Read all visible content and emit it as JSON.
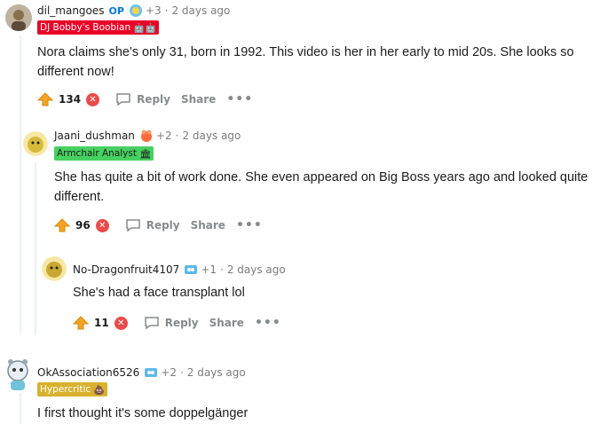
{
  "colors": {
    "upvote": "#f2a325",
    "downvote": "#ea4a4a",
    "op": "#0079d3",
    "flair_red": "#ea0027",
    "flair_green": "#46d160",
    "flair_yellow": "#d8b12e"
  },
  "actions": {
    "reply": "Reply",
    "share": "Share",
    "more": "•••"
  },
  "comments": [
    {
      "username": "dil_mangoes",
      "op_badge": "OP",
      "award_count": "+3",
      "separator": "·",
      "time": "2 days ago",
      "flair": "DJ Bobby's Boobian",
      "flair_emoji": "🤖🤖",
      "body": "Nora claims she's only 31, born in 1992. This video is her in her early to mid 20s. She looks so different now!",
      "score": "134"
    },
    {
      "username": "Jaani_dushman",
      "award_count": "+2",
      "separator": "·",
      "time": "2 days ago",
      "flair": "Armchair Analyst",
      "flair_emoji": "🏛",
      "body": "She has quite a bit of work done. She even appeared on Big Boss years ago and looked quite different.",
      "score": "96"
    },
    {
      "username": "No-Dragonfruit4107",
      "award_count": "+1",
      "separator": "·",
      "time": "2 days ago",
      "body": "She's had a face transplant lol",
      "score": "11"
    },
    {
      "username": "OkAssociation6526",
      "award_count": "+2",
      "separator": "·",
      "time": "2 days ago",
      "flair": "Hypercritic",
      "flair_emoji": "💩",
      "body": "I first thought it's some doppelgänger"
    }
  ]
}
